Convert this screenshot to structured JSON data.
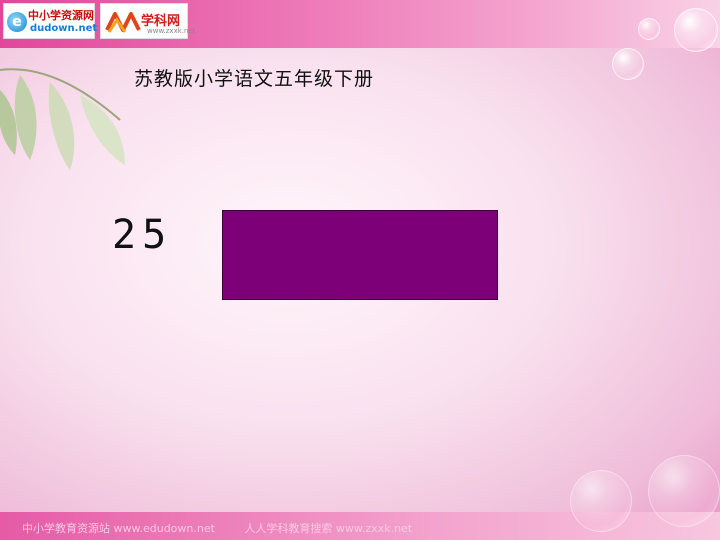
{
  "header": {
    "logo_left": {
      "icon": "e",
      "line1": "中小学资源网",
      "line2": "dudown.net"
    },
    "logo_right": {
      "line1": "学科网",
      "line2": "www.zxxk.net"
    }
  },
  "title": "苏教版小学语文五年级下册",
  "lesson_number": "25",
  "title_box": {
    "color": "#7d0079"
  },
  "footer": {
    "left": "中小学教育资源站 www.edudown.net",
    "right": "人人学科教育搜索 www.zxxk.net"
  },
  "colors": {
    "accent": "#e2479a",
    "box": "#7d0079"
  }
}
